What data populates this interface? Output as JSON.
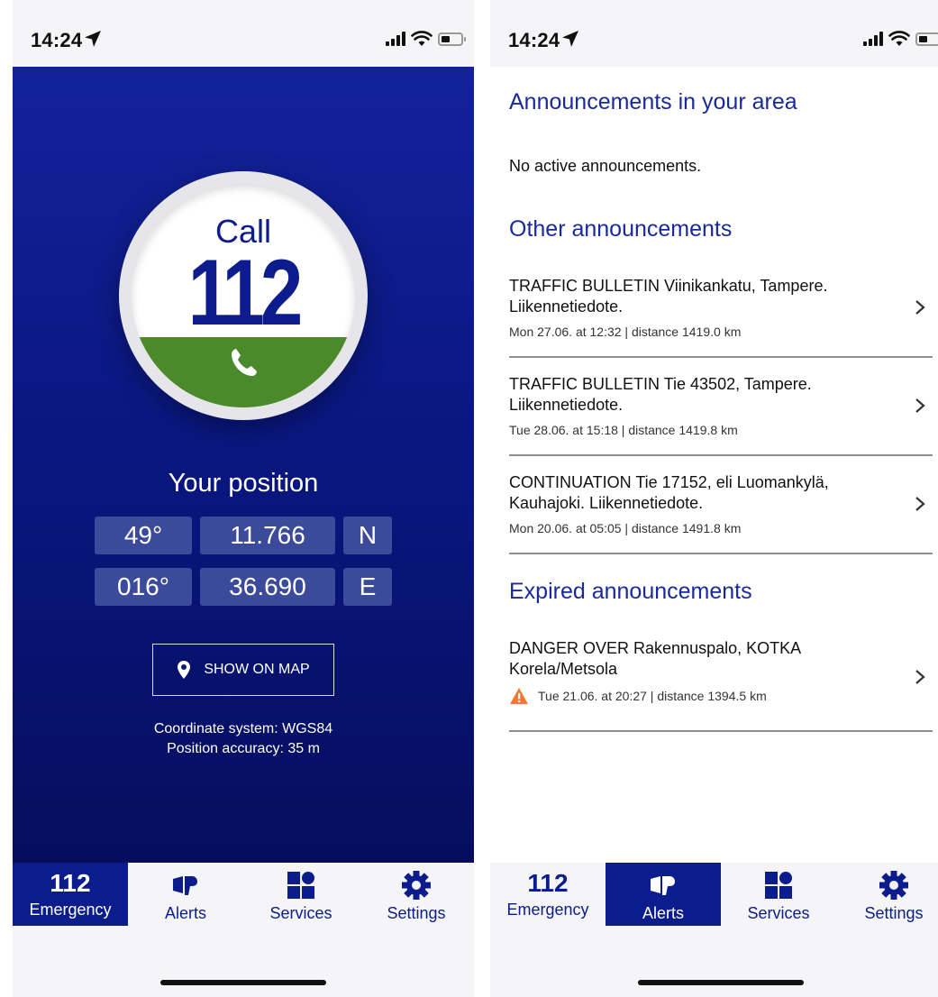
{
  "status_bar": {
    "time": "14:24"
  },
  "emergency": {
    "call_word": "Call",
    "call_number": "112",
    "position_title": "Your position",
    "latitude": {
      "degrees": "49°",
      "minutes": "11.766",
      "hemisphere": "N"
    },
    "longitude": {
      "degrees": "016°",
      "minutes": "36.690",
      "hemisphere": "E"
    },
    "show_map_label": "SHOW ON MAP",
    "coordinate_system": "Coordinate system: WGS84",
    "position_accuracy": "Position accuracy: 35 m",
    "colors": {
      "background": "#0a1782",
      "call_green": "#4b8a2b"
    }
  },
  "alerts": {
    "area_title": "Announcements in your area",
    "no_active": "No active announcements.",
    "other_title": "Other announcements",
    "other": [
      {
        "title": "TRAFFIC BULLETIN Viinikankatu, Tampere. Liikennetiedote.",
        "meta": "Mon 27.06. at 12:32 | distance 1419.0 km"
      },
      {
        "title": "TRAFFIC BULLETIN Tie 43502, Tampere. Liikennetiedote.",
        "meta": "Tue 28.06. at 15:18 | distance 1419.8 km"
      },
      {
        "title": "CONTINUATION Tie 17152, eli Luomankylä, Kauhajoki. Liikennetiedote.",
        "meta": "Mon 20.06. at 05:05 | distance 1491.8 km"
      }
    ],
    "expired_title": "Expired announcements",
    "expired": [
      {
        "title": "DANGER OVER Rakennuspalo, KOTKA Korela/Metsola",
        "meta": "Tue 21.06. at 20:27 | distance 1394.5 km",
        "icon": "warning-icon"
      }
    ]
  },
  "tabbar": {
    "emergency_number": "112",
    "tabs": [
      {
        "label": "Emergency",
        "icon": "112"
      },
      {
        "label": "Alerts",
        "icon": "megaphone-icon"
      },
      {
        "label": "Services",
        "icon": "grid-icon"
      },
      {
        "label": "Settings",
        "icon": "gear-icon"
      }
    ],
    "active_color": "#0b1c8c"
  }
}
